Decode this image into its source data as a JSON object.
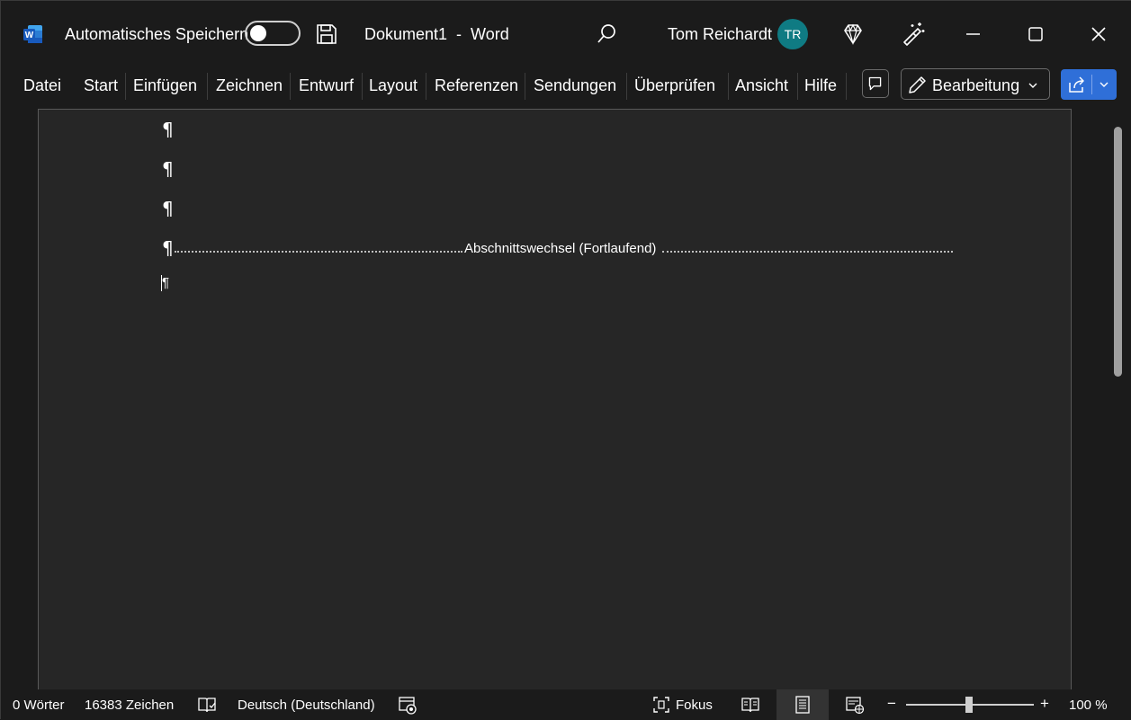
{
  "titlebar": {
    "autosave_label": "Automatisches Speichern",
    "document_title": "Dokument1  -  Word",
    "user_name": "Tom Reichardt",
    "user_initials": "TR"
  },
  "ribbon": {
    "tabs": [
      "Datei",
      "Start",
      "Einfügen",
      "Zeichnen",
      "Entwurf",
      "Layout",
      "Referenzen",
      "Sendungen",
      "Überprüfen",
      "Ansicht",
      "Hilfe"
    ],
    "edit_mode_label": "Bearbeitung"
  },
  "document": {
    "paragraph_mark": "¶",
    "section_break_label": "Abschnittswechsel (Fortlaufend)"
  },
  "statusbar": {
    "word_count": "0 Wörter",
    "char_count": "16383 Zeichen",
    "language": "Deutsch (Deutschland)",
    "focus_label": "Fokus",
    "zoom_minus": "−",
    "zoom_plus": "+",
    "zoom_level": "100 %"
  },
  "colors": {
    "background": "#1b1b1b",
    "page": "#262626",
    "avatar": "#0f7b83",
    "share_button": "#2f6fd8"
  }
}
